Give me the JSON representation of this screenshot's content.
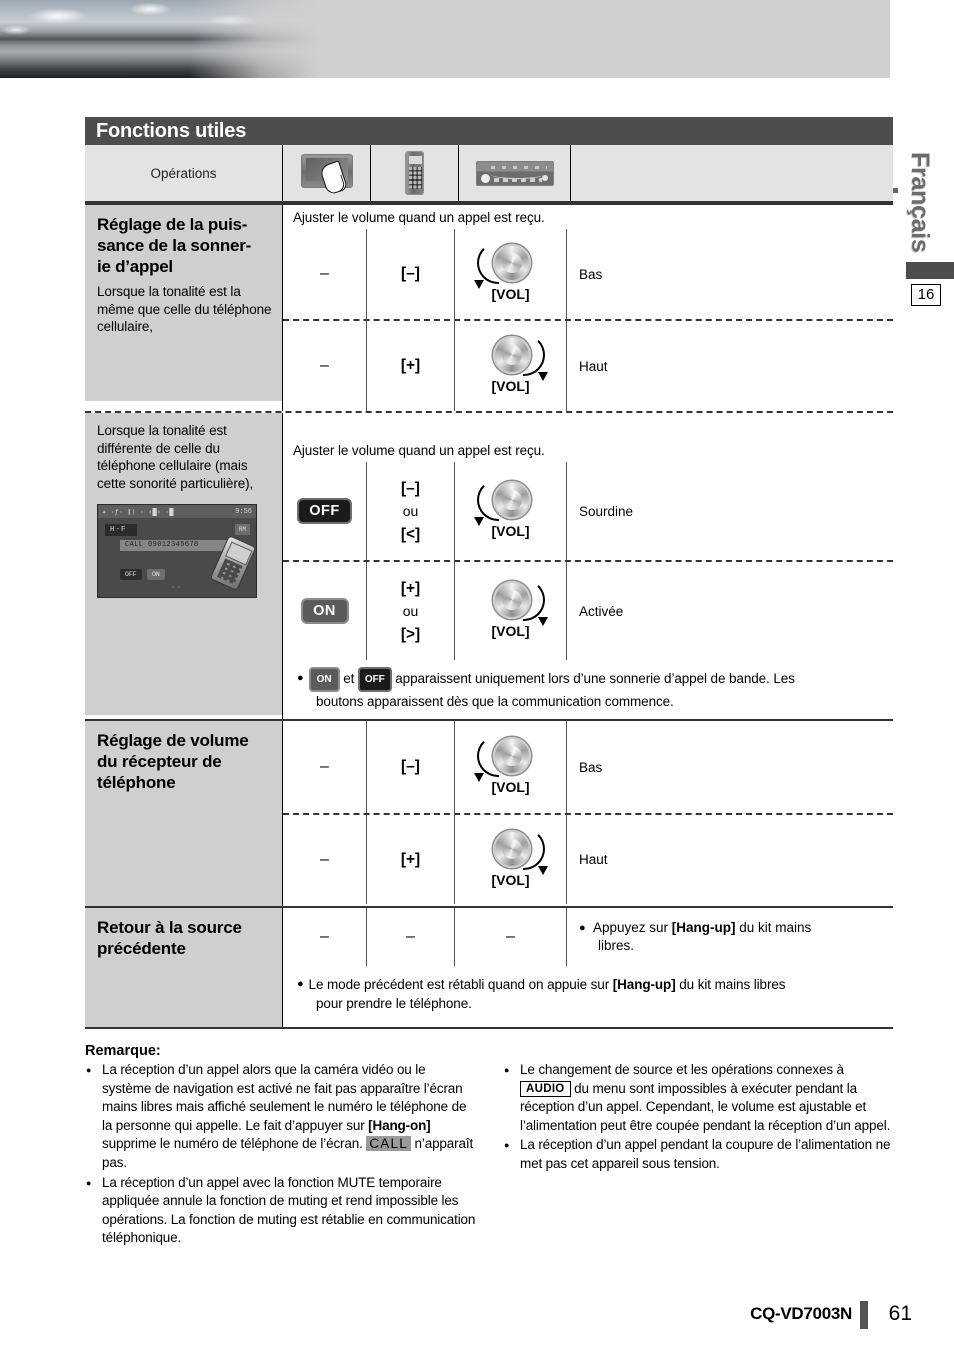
{
  "banner": {
    "alt": "landscape-photo-banner"
  },
  "side": {
    "language": "Français",
    "chapter_number": "16"
  },
  "table": {
    "title": "Fonctions utiles",
    "header": {
      "operations_label": "Opérations",
      "icons": [
        "touchscreen-icon",
        "remote-control-icon",
        "head-unit-icon"
      ]
    },
    "sections": [
      {
        "heading": "Réglage de la puis-\nsance de la sonner-\nie d’appel",
        "heading_l1": "Réglage de la puis-",
        "heading_l2": "sance de la sonner-",
        "heading_l3": "ie d’appel",
        "sub": "Lorsque la tonalité est la même que celle du téléphone cellulaire,",
        "intro": "Ajuster le volume quand un appel est reçu.",
        "rows": [
          {
            "touch": "–",
            "remote": "[–]",
            "unit": "[VOL]",
            "result": "Bas"
          },
          {
            "touch": "–",
            "remote": "[+]",
            "unit": "[VOL]",
            "result": "Haut"
          }
        ]
      },
      {
        "sub": "Lorsque la tonalité est différente de celle du téléphone cellulaire (mais cette sonorité particulière),",
        "intro": "Ajuster le volume quand un appel est reçu.",
        "rows": [
          {
            "touch": "OFF",
            "remote_a": "[–]",
            "remote_ou": "ou",
            "remote_b": "[<]",
            "unit": "[VOL]",
            "result": "Sourdine"
          },
          {
            "touch": "ON",
            "remote_a": "[+]",
            "remote_ou": "ou",
            "remote_b": "[>]",
            "unit": "[VOL]",
            "result": "Activée"
          }
        ],
        "note_on": "ON",
        "note_off": "OFF",
        "note_a": " et ",
        "note_b": " apparaissent uniquement lors d’une sonnerie d’appel de bande. Les",
        "note_c": "boutons apparaissent dès que la communication commence.",
        "lcd": {
          "status_left": "✦ ·ƒ· ❙❘ · ‹█› ·█",
          "clock": "9:56",
          "mode": "H-F",
          "badge": "RM",
          "call": "CALL  09012345678",
          "btn_off": "OFF",
          "btn_on": "ON",
          "dots": "··"
        }
      },
      {
        "heading_l1": "Réglage de volume",
        "heading_l2": "du récepteur de",
        "heading_l3": "téléphone",
        "rows": [
          {
            "touch": "–",
            "remote": "[–]",
            "unit": "[VOL]",
            "result": "Bas"
          },
          {
            "touch": "–",
            "remote": "[+]",
            "unit": "[VOL]",
            "result": "Haut"
          }
        ]
      },
      {
        "heading_l1": "Retour à la source",
        "heading_l2": "précédente",
        "rows": [
          {
            "touch": "–",
            "remote": "–",
            "unit": "–"
          }
        ],
        "result_bullet_a": "Appuyez sur ",
        "result_bullet_key": "[Hang-up]",
        "result_bullet_b": " du kit mains",
        "result_bullet_c": "libres.",
        "note_a": "Le mode précédent est rétabli quand on appuie sur ",
        "note_key": "[Hang-up]",
        "note_b": " du kit mains libres",
        "note_c": "pour prendre le téléphone."
      }
    ]
  },
  "remarque": {
    "title": "Remarque:",
    "left": [
      {
        "part1": "La réception d’un appel alors que la caméra vidéo ou le système de navigation est activé ne fait pas apparaître l’écran mains libres mais affiché seulement le numéro le téléphone de la personne qui appelle. Le fait d’appuyer sur ",
        "key": "[Hang-on]",
        "part2": " supprime le numéro de téléphone de l’écran. ",
        "inverse": "CALL",
        "part3": " n’apparaît pas."
      },
      {
        "part1": "La réception d’un appel avec la fonction MUTE temporaire appliquée annule la fonction de muting et rend impossible les opérations. La fonction de muting est rétablie en communication téléphonique."
      }
    ],
    "right": [
      {
        "part1": "Le changement de source et les opérations connexes à ",
        "boxed": "AUDIO",
        "part2": " du menu sont impossibles à exécuter pendant la réception d’un appel. Cependant, le volume est ajustable et l’alimentation peut être coupée pendant la réception d’un appel."
      },
      {
        "part1": "La réception d’un appel pendant la coupure de l’alimentation ne met pas cet appareil sous tension."
      }
    ]
  },
  "footer": {
    "model": "CQ-VD7003N",
    "page": "61"
  }
}
